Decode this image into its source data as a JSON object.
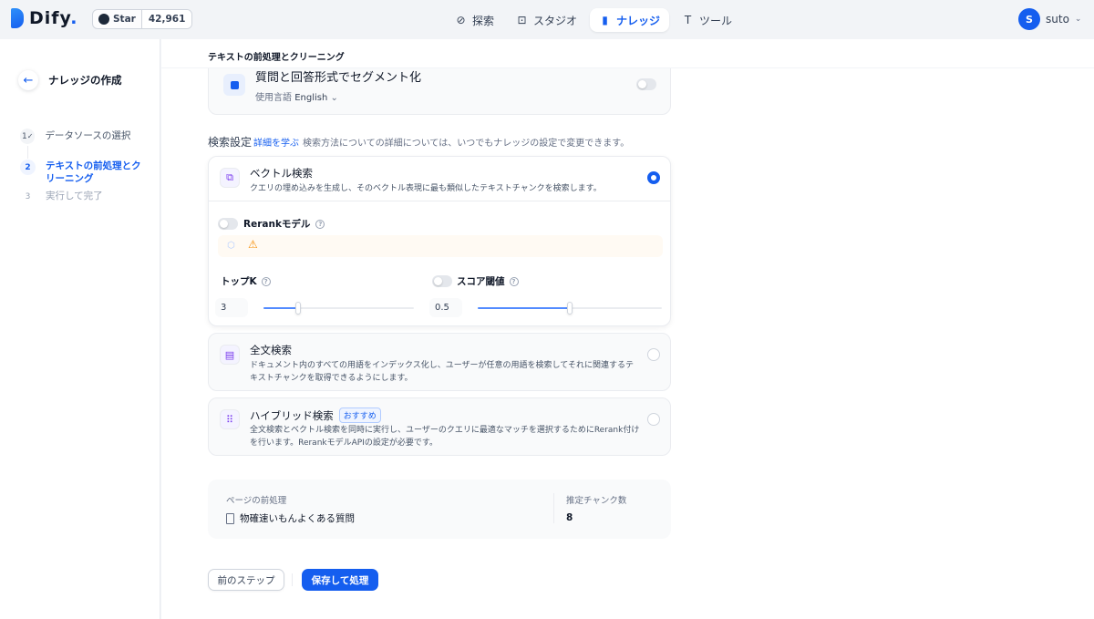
{
  "app": {
    "logo_text": "Dify",
    "logo_dot": ".",
    "github_star_label": "Star",
    "github_star_count": "42,961"
  },
  "nav": {
    "items": [
      {
        "label": "探索",
        "icon": "compass-icon"
      },
      {
        "label": "スタジオ",
        "icon": "robot-icon"
      },
      {
        "label": "ナレッジ",
        "icon": "book-icon",
        "active": true
      },
      {
        "label": "ツール",
        "icon": "tool-icon"
      }
    ]
  },
  "user": {
    "initial": "S",
    "name": "suto"
  },
  "sidebar": {
    "title": "ナレッジの作成",
    "steps": [
      {
        "num": "1",
        "label": "データソースの選択",
        "state": "done"
      },
      {
        "num": "2",
        "label": "テキストの前処理とクリーニング",
        "state": "active"
      },
      {
        "num": "3",
        "label": "実行して完了",
        "state": "todo"
      }
    ]
  },
  "main": {
    "header": "テキストの前処理とクリーニング",
    "qa": {
      "title": "質問と回答形式でセグメント化",
      "lang_label": "使用言語",
      "lang_value": "English"
    },
    "search": {
      "title": "検索設定",
      "link": "詳細を学ぶ",
      "desc": "検索方法についての詳細については、いつでもナレッジの設定で変更できます。"
    },
    "vector": {
      "title": "ベクトル検索",
      "desc": "クエリの埋め込みを生成し、そのベクトル表現に最も類似したテキストチャンクを検索します。",
      "rerank_label": "Rerankモデル",
      "topk_label": "トップK",
      "topk_value": "3",
      "topk_fraction": 0.23,
      "score_label": "スコア閾値",
      "score_value": "0.5",
      "score_fraction": 0.5
    },
    "fulltext": {
      "title": "全文検索",
      "desc": "ドキュメント内のすべての用語をインデックス化し、ユーザーが任意の用語を検索してそれに関連するテキストチャンクを取得できるようにします。"
    },
    "hybrid": {
      "title": "ハイブリッド検索",
      "badge": "おすすめ",
      "desc": "全文検索とベクトル検索を同時に実行し、ユーザーのクエリに最適なマッチを選択するためにRerank付けを行います。RerankモデルAPIの設定が必要です。"
    },
    "summary": {
      "label": "ページの前処理",
      "file": "物確速いもんよくある質問",
      "chunk_label": "推定チャンク数",
      "chunk_count": "8"
    },
    "buttons": {
      "prev": "前のステップ",
      "save": "保存して処理"
    }
  },
  "colors": {
    "accent": "#155eef",
    "warning": "#f79009"
  }
}
